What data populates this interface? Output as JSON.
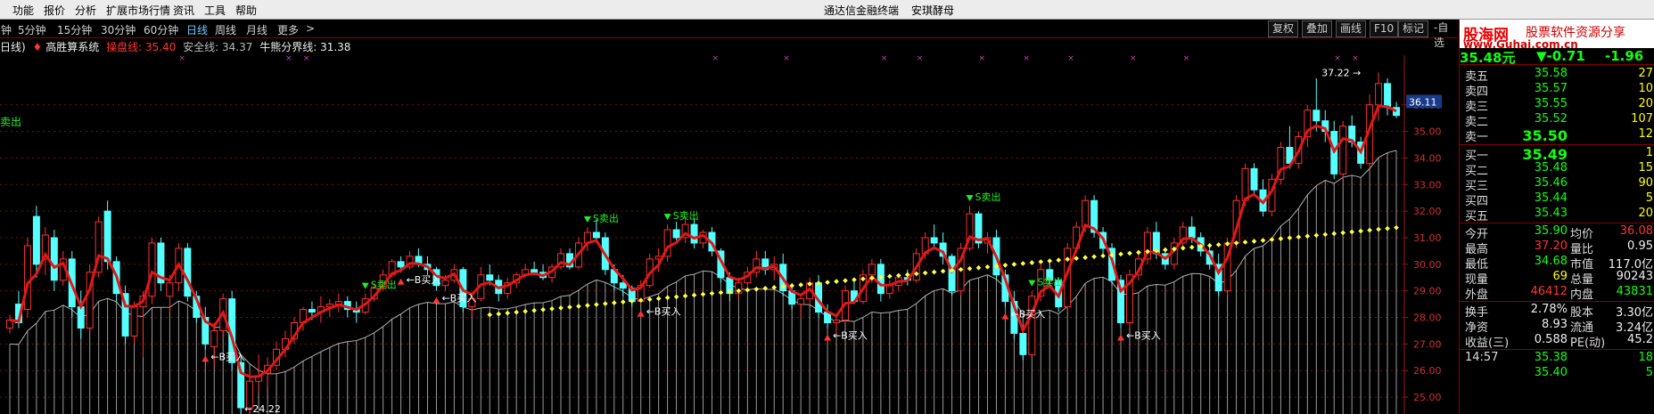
{
  "menu": {
    "items": [
      "功能",
      "报价",
      "分析",
      "扩展市场行情",
      "资讯",
      "工具",
      "帮助"
    ],
    "app_title": "通达信金融终端",
    "stock_name": "安琪酵母"
  },
  "periods": {
    "items": [
      "钟",
      "5分钟",
      "15分钟",
      "30分钟",
      "60分钟",
      "日线",
      "周线",
      "月线",
      "更多",
      ">"
    ],
    "active": "日线",
    "right_buttons": [
      "复权",
      "叠加",
      "画线",
      "F10",
      "标记",
      "-自选"
    ]
  },
  "indicator": {
    "prefix": "日线)",
    "system_name": "高胜算系统",
    "lines": [
      {
        "label": "操盘线: 35.40",
        "color": "#ff3333"
      },
      {
        "label": "安全线: 34.37",
        "color": "#bbbbbb"
      },
      {
        "label": "牛熊分界线: 31.38",
        "color": "#ffffff"
      }
    ],
    "left_label": "卖出"
  },
  "chart_data": {
    "type": "candlestick",
    "ylim": [
      24.5,
      37.6
    ],
    "yticks": [
      "25.00",
      "26.00",
      "27.00",
      "28.00",
      "29.00",
      "30.00",
      "31.00",
      "32.00",
      "33.00",
      "34.00",
      "35.00",
      "36.00"
    ],
    "current_price_label": "36.11",
    "high_label": "37.22",
    "low_label": "24.22",
    "colors": {
      "up": "#ff3030",
      "down": "#54ffff",
      "mainline": "#e01818",
      "safety": "#b0b0b0",
      "bullbear": "#ffff44",
      "signal_buy": "#ff3333",
      "signal_sell": "#22ee22"
    },
    "candles": [
      [
        27.6,
        28.1,
        27.4,
        27.9
      ],
      [
        28.5,
        29.0,
        27.6,
        27.8
      ],
      [
        28.3,
        31.0,
        28.0,
        30.7
      ],
      [
        31.8,
        32.2,
        29.5,
        30.0
      ],
      [
        30.2,
        31.4,
        29.6,
        31.1
      ],
      [
        31.0,
        31.3,
        29.0,
        29.4
      ],
      [
        29.4,
        30.5,
        29.2,
        30.2
      ],
      [
        30.2,
        30.5,
        28.0,
        28.4
      ],
      [
        28.4,
        29.0,
        27.2,
        27.6
      ],
      [
        27.6,
        30.0,
        27.4,
        29.7
      ],
      [
        29.7,
        31.8,
        29.5,
        31.6
      ],
      [
        32.0,
        32.4,
        29.8,
        30.1
      ],
      [
        30.1,
        30.3,
        28.6,
        28.9
      ],
      [
        28.9,
        29.2,
        27.0,
        27.3
      ],
      [
        27.3,
        28.6,
        27.0,
        28.4
      ],
      [
        28.4,
        29.0,
        26.5,
        28.8
      ],
      [
        28.8,
        31.0,
        28.5,
        30.8
      ],
      [
        30.8,
        31.0,
        29.0,
        29.3
      ],
      [
        28.8,
        29.6,
        28.2,
        29.3
      ],
      [
        29.3,
        30.8,
        29.0,
        30.6
      ],
      [
        30.6,
        30.8,
        28.6,
        28.8
      ],
      [
        28.8,
        29.0,
        27.8,
        28.0
      ],
      [
        28.0,
        28.4,
        26.8,
        27.0
      ],
      [
        26.9,
        27.8,
        26.2,
        27.5
      ],
      [
        27.5,
        28.9,
        27.2,
        28.7
      ],
      [
        28.7,
        29.0,
        26.0,
        26.3
      ],
      [
        26.3,
        26.5,
        24.3,
        24.6
      ],
      [
        24.6,
        26.0,
        24.2,
        25.6
      ],
      [
        25.6,
        26.6,
        25.2,
        25.8
      ],
      [
        25.9,
        26.5,
        25.4,
        26.2
      ],
      [
        26.2,
        27.1,
        26.0,
        26.8
      ],
      [
        26.8,
        27.5,
        26.5,
        27.2
      ],
      [
        27.2,
        28.0,
        27.0,
        27.8
      ],
      [
        27.8,
        28.4,
        27.5,
        28.3
      ],
      [
        28.3,
        28.6,
        27.9,
        28.2
      ],
      [
        28.2,
        28.8,
        27.8,
        28.4
      ],
      [
        28.4,
        28.7,
        28.0,
        28.5
      ],
      [
        28.5,
        28.9,
        28.2,
        28.6
      ],
      [
        28.6,
        28.8,
        28.0,
        28.3
      ],
      [
        28.3,
        28.6,
        27.8,
        28.2
      ],
      [
        28.2,
        28.9,
        28.1,
        28.7
      ],
      [
        28.7,
        29.3,
        28.6,
        29.1
      ],
      [
        29.1,
        29.8,
        29.0,
        29.6
      ],
      [
        29.6,
        30.2,
        29.5,
        30.1
      ],
      [
        30.1,
        30.3,
        29.7,
        29.9
      ],
      [
        29.9,
        30.5,
        29.8,
        30.3
      ],
      [
        30.3,
        30.6,
        29.9,
        30.0
      ],
      [
        30.0,
        30.3,
        29.6,
        29.8
      ],
      [
        29.8,
        29.9,
        29.0,
        29.2
      ],
      [
        29.2,
        29.6,
        29.0,
        29.4
      ],
      [
        29.4,
        30.0,
        29.3,
        29.8
      ],
      [
        29.8,
        29.9,
        28.2,
        28.4
      ],
      [
        28.4,
        28.9,
        28.0,
        28.7
      ],
      [
        28.7,
        29.9,
        28.6,
        29.6
      ],
      [
        29.6,
        30.0,
        29.2,
        29.4
      ],
      [
        29.4,
        29.6,
        28.6,
        28.9
      ],
      [
        28.9,
        29.5,
        28.7,
        29.3
      ],
      [
        29.3,
        29.7,
        29.1,
        29.6
      ],
      [
        29.6,
        30.0,
        29.5,
        29.8
      ],
      [
        29.8,
        30.1,
        29.6,
        29.7
      ],
      [
        29.7,
        30.0,
        29.4,
        29.5
      ],
      [
        29.5,
        30.0,
        29.3,
        29.9
      ],
      [
        29.9,
        30.6,
        29.8,
        30.4
      ],
      [
        30.4,
        30.6,
        29.8,
        29.9
      ],
      [
        29.9,
        31.0,
        29.8,
        30.8
      ],
      [
        30.8,
        31.4,
        30.5,
        31.2
      ],
      [
        31.2,
        31.7,
        30.8,
        31.0
      ],
      [
        31.0,
        31.2,
        29.6,
        29.8
      ],
      [
        29.8,
        30.0,
        29.0,
        29.3
      ],
      [
        29.3,
        29.6,
        28.8,
        29.1
      ],
      [
        29.1,
        29.2,
        28.4,
        28.6
      ],
      [
        28.6,
        29.4,
        28.5,
        29.2
      ],
      [
        29.2,
        30.4,
        29.1,
        30.2
      ],
      [
        30.2,
        30.6,
        29.7,
        30.3
      ],
      [
        30.3,
        31.5,
        30.1,
        31.3
      ],
      [
        31.3,
        31.6,
        30.9,
        31.0
      ],
      [
        31.0,
        31.8,
        30.8,
        31.5
      ],
      [
        31.5,
        31.7,
        30.6,
        30.8
      ],
      [
        30.8,
        31.3,
        30.6,
        31.2
      ],
      [
        31.2,
        31.4,
        30.3,
        30.5
      ],
      [
        30.5,
        30.6,
        29.3,
        29.5
      ],
      [
        29.5,
        29.7,
        28.6,
        28.9
      ],
      [
        28.9,
        29.5,
        28.7,
        29.3
      ],
      [
        29.3,
        29.9,
        29.0,
        29.7
      ],
      [
        29.7,
        30.5,
        29.5,
        30.2
      ],
      [
        30.2,
        30.5,
        29.6,
        29.8
      ],
      [
        29.8,
        30.3,
        29.4,
        30.0
      ],
      [
        30.0,
        30.4,
        28.8,
        29.0
      ],
      [
        29.0,
        29.3,
        28.3,
        28.5
      ],
      [
        28.5,
        28.9,
        28.0,
        28.7
      ],
      [
        28.7,
        29.5,
        28.5,
        29.3
      ],
      [
        29.3,
        29.6,
        28.0,
        28.2
      ],
      [
        28.2,
        28.5,
        27.6,
        27.8
      ],
      [
        27.8,
        28.1,
        27.4,
        27.9
      ],
      [
        27.9,
        29.2,
        27.8,
        29.0
      ],
      [
        29.0,
        29.4,
        28.5,
        28.6
      ],
      [
        28.6,
        29.8,
        28.5,
        29.6
      ],
      [
        29.6,
        30.2,
        29.3,
        30.0
      ],
      [
        30.0,
        30.2,
        28.6,
        28.9
      ],
      [
        28.9,
        29.4,
        28.7,
        29.2
      ],
      [
        29.2,
        29.6,
        29.0,
        29.5
      ],
      [
        29.5,
        29.8,
        29.2,
        29.4
      ],
      [
        29.4,
        30.6,
        29.3,
        30.4
      ],
      [
        30.4,
        31.2,
        30.2,
        31.0
      ],
      [
        31.0,
        31.5,
        30.6,
        30.8
      ],
      [
        30.8,
        31.2,
        30.0,
        30.3
      ],
      [
        30.3,
        30.4,
        28.8,
        29.0
      ],
      [
        29.0,
        30.8,
        28.8,
        30.6
      ],
      [
        30.6,
        32.2,
        30.5,
        31.9
      ],
      [
        31.9,
        32.0,
        30.6,
        30.8
      ],
      [
        30.8,
        31.2,
        30.4,
        31.0
      ],
      [
        31.0,
        31.3,
        29.4,
        29.6
      ],
      [
        29.6,
        29.8,
        28.4,
        28.6
      ],
      [
        28.6,
        29.0,
        27.2,
        27.4
      ],
      [
        27.4,
        27.6,
        26.4,
        26.6
      ],
      [
        26.6,
        29.0,
        26.5,
        28.8
      ],
      [
        28.8,
        30.0,
        28.6,
        29.8
      ],
      [
        29.8,
        30.2,
        29.2,
        29.4
      ],
      [
        29.4,
        29.5,
        28.2,
        28.4
      ],
      [
        28.4,
        30.8,
        28.2,
        30.6
      ],
      [
        30.6,
        31.6,
        30.4,
        31.4
      ],
      [
        31.4,
        32.6,
        31.2,
        32.4
      ],
      [
        32.4,
        32.6,
        31.0,
        31.2
      ],
      [
        31.2,
        31.4,
        30.4,
        30.6
      ],
      [
        30.6,
        30.8,
        29.2,
        29.4
      ],
      [
        29.4,
        29.6,
        27.6,
        27.8
      ],
      [
        27.8,
        29.8,
        27.6,
        29.6
      ],
      [
        29.6,
        30.4,
        29.4,
        30.2
      ],
      [
        30.2,
        31.4,
        30.0,
        31.2
      ],
      [
        31.2,
        31.6,
        30.2,
        30.4
      ],
      [
        30.4,
        30.6,
        29.8,
        30.0
      ],
      [
        30.0,
        31.0,
        29.8,
        30.8
      ],
      [
        30.8,
        31.6,
        30.6,
        31.4
      ],
      [
        31.4,
        31.8,
        30.8,
        31.0
      ],
      [
        31.0,
        31.2,
        30.3,
        30.5
      ],
      [
        30.5,
        30.8,
        29.8,
        30.0
      ],
      [
        30.0,
        30.4,
        28.8,
        29.0
      ],
      [
        29.0,
        31.0,
        28.8,
        30.8
      ],
      [
        30.8,
        32.6,
        30.6,
        32.4
      ],
      [
        32.4,
        33.8,
        32.2,
        33.6
      ],
      [
        33.6,
        33.8,
        32.6,
        32.8
      ],
      [
        32.8,
        33.2,
        31.8,
        32.0
      ],
      [
        32.0,
        33.4,
        31.8,
        33.2
      ],
      [
        33.2,
        34.6,
        33.0,
        34.4
      ],
      [
        34.4,
        35.2,
        33.6,
        33.8
      ],
      [
        33.8,
        35.0,
        33.6,
        34.8
      ],
      [
        34.8,
        36.0,
        34.4,
        35.8
      ],
      [
        35.8,
        37.0,
        35.0,
        35.4
      ],
      [
        35.4,
        35.8,
        34.6,
        35.0
      ],
      [
        35.0,
        35.4,
        33.2,
        33.4
      ],
      [
        33.4,
        35.4,
        33.2,
        35.2
      ],
      [
        35.2,
        35.6,
        34.4,
        34.6
      ],
      [
        34.6,
        34.8,
        33.6,
        33.8
      ],
      [
        33.8,
        36.4,
        33.6,
        36.0
      ],
      [
        36.0,
        37.22,
        35.4,
        36.8
      ],
      [
        36.8,
        37.0,
        35.6,
        35.9
      ],
      [
        35.9,
        36.11,
        35.5,
        35.6
      ]
    ],
    "signals": [
      {
        "i": 22,
        "text": "B买入",
        "type": "buy"
      },
      {
        "i": 40,
        "text": "S卖出",
        "type": "sell"
      },
      {
        "i": 44,
        "text": "B买入",
        "type": "buy"
      },
      {
        "i": 48,
        "text": "B买入",
        "type": "buy"
      },
      {
        "i": 65,
        "text": "S卖出",
        "type": "sell"
      },
      {
        "i": 71,
        "text": "B买入",
        "type": "buy"
      },
      {
        "i": 74,
        "text": "S卖出",
        "type": "sell"
      },
      {
        "i": 92,
        "text": "B买入",
        "type": "buy"
      },
      {
        "i": 108,
        "text": "S卖出",
        "type": "sell"
      },
      {
        "i": 112,
        "text": "B买入",
        "type": "buy"
      },
      {
        "i": 115,
        "text": "S卖出",
        "type": "sell"
      },
      {
        "i": 125,
        "text": "B买入",
        "type": "buy"
      }
    ]
  },
  "quote_panel": {
    "logo_main": "股海网",
    "logo_sub": "股票软件资源分享",
    "logo_url": "www.Guhai.com.cn",
    "price": "35.48元",
    "change": "▼-0.71",
    "change_pct": "-1.96",
    "sell": [
      {
        "label": "卖五",
        "price": "35.58",
        "vol": "27"
      },
      {
        "label": "卖四",
        "price": "35.57",
        "vol": "10"
      },
      {
        "label": "卖三",
        "price": "35.55",
        "vol": "20"
      },
      {
        "label": "卖二",
        "price": "35.52",
        "vol": "107"
      },
      {
        "label": "卖一",
        "price": "35.50",
        "vol": "12"
      }
    ],
    "buy": [
      {
        "label": "买一",
        "price": "35.49",
        "vol": "1"
      },
      {
        "label": "买二",
        "price": "35.48",
        "vol": "15"
      },
      {
        "label": "买三",
        "price": "35.46",
        "vol": "90"
      },
      {
        "label": "买四",
        "price": "35.44",
        "vol": "5"
      },
      {
        "label": "买五",
        "price": "35.43",
        "vol": "20"
      }
    ],
    "stats1": [
      {
        "l1": "今开",
        "v1": "35.90",
        "l2": "均价",
        "v2": "36.08"
      },
      {
        "l1": "最高",
        "v1": "37.20",
        "l2": "量比",
        "v2": "0.95"
      },
      {
        "l1": "最低",
        "v1": "34.68",
        "l2": "市值",
        "v2": "117.0亿"
      },
      {
        "l1": "现量",
        "v1": "69",
        "l2": "总量",
        "v2": "90243"
      },
      {
        "l1": "外盘",
        "v1": "46412",
        "l2": "内盘",
        "v2": "43831"
      }
    ],
    "stats2": [
      {
        "l1": "换手",
        "v1": "2.78%",
        "l2": "股本",
        "v2": "3.30亿"
      },
      {
        "l1": "净资",
        "v1": "8.93",
        "l2": "流通",
        "v2": "3.24亿"
      },
      {
        "l1": "收益(三)",
        "v1": "0.588",
        "l2": "PE(动)",
        "v2": "45.2"
      }
    ],
    "ticks": [
      {
        "time": "14:57",
        "price": "35.38",
        "vol": "18"
      },
      {
        "time": "",
        "price": "35.40",
        "vol": "5"
      }
    ]
  }
}
